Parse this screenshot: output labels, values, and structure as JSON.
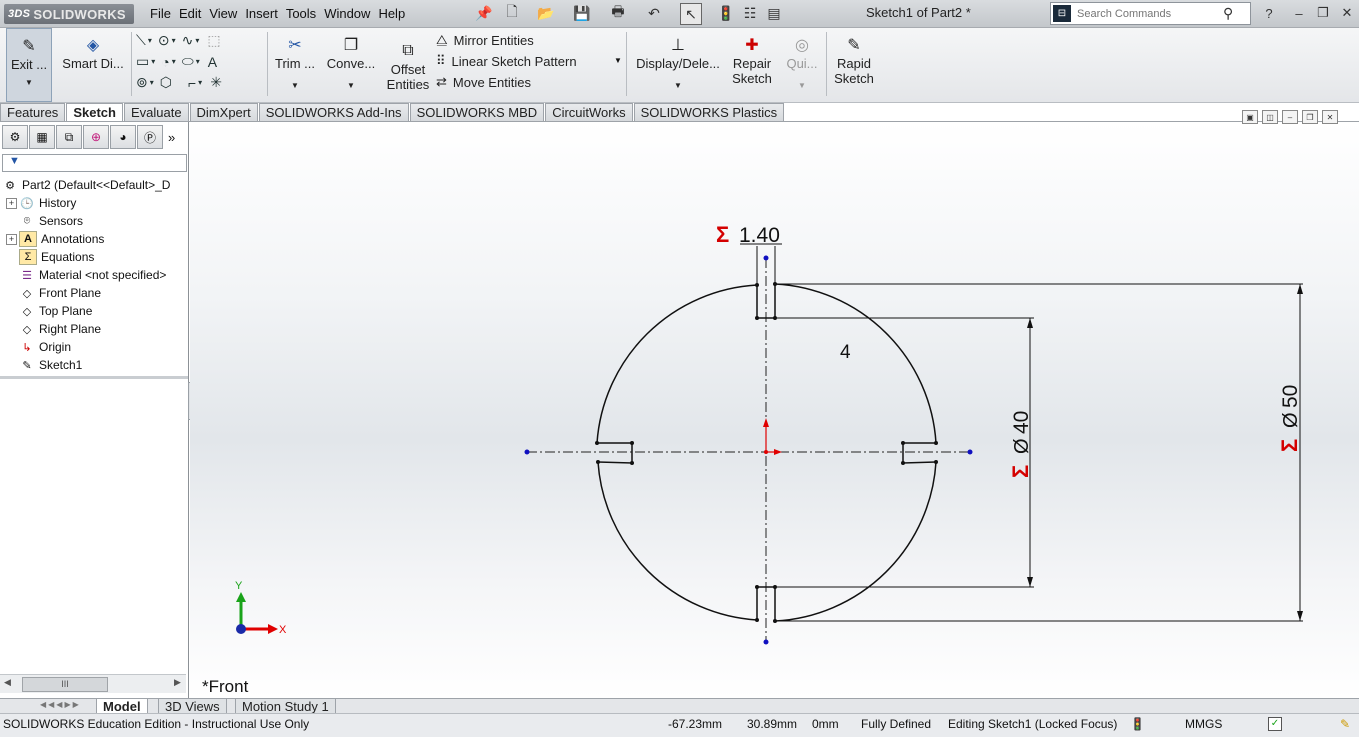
{
  "app": {
    "logo_text": "SOLIDWORKS",
    "logo_prefix": "3DS",
    "document_title": "Sketch1 of Part2 *"
  },
  "menu": [
    "File",
    "Edit",
    "View",
    "Insert",
    "Tools",
    "Window",
    "Help"
  ],
  "search": {
    "placeholder": "Search Commands"
  },
  "command_manager": {
    "exit_sketch": "Exit ...",
    "smart_dimension": "Smart Di...",
    "trim": "Trim ...",
    "convert": "Conve...",
    "offset": "Offset",
    "offset_2": "Entities",
    "mirror": "Mirror Entities",
    "linear_pattern": "Linear Sketch Pattern",
    "move": "Move Entities",
    "display_delete": "Display/Dele...",
    "repair": "Repair",
    "repair_2": "Sketch",
    "quick": "Qui...",
    "rapid": "Rapid",
    "rapid_2": "Sketch"
  },
  "tabs": [
    "Features",
    "Sketch",
    "Evaluate",
    "DimXpert",
    "SOLIDWORKS Add-Ins",
    "SOLIDWORKS MBD",
    "CircuitWorks",
    "SOLIDWORKS Plastics"
  ],
  "active_tab": "Sketch",
  "feature_tree": {
    "root": "Part2  (Default<<Default>_D",
    "items": [
      {
        "label": "History",
        "expandable": true
      },
      {
        "label": "Sensors",
        "expandable": false
      },
      {
        "label": "Annotations",
        "expandable": true
      },
      {
        "label": "Equations",
        "expandable": false
      },
      {
        "label": "Material <not specified>",
        "expandable": false
      },
      {
        "label": "Front Plane",
        "expandable": false
      },
      {
        "label": "Top Plane",
        "expandable": false
      },
      {
        "label": "Right Plane",
        "expandable": false
      },
      {
        "label": "Origin",
        "expandable": false
      },
      {
        "label": "Sketch1",
        "expandable": false
      }
    ]
  },
  "panel_scroll_label": "III",
  "graphics": {
    "view_name": "*Front",
    "dim_slot_width": "1.40",
    "dim_inner": "40",
    "dim_outer": "50",
    "dim_symbol": "Ø",
    "sum_symbol": "Σ",
    "pattern_count": "4",
    "axis_x": "X",
    "axis_y": "Y"
  },
  "bottom_tabs": [
    "Model",
    "3D Views",
    "Motion Study 1"
  ],
  "status": {
    "left": "SOLIDWORKS Education Edition - Instructional Use Only",
    "x": "-67.23mm",
    "y": "30.89mm",
    "z": "0mm",
    "state": "Fully Defined",
    "editing": "Editing Sketch1 (Locked Focus)",
    "units": "MMGS"
  },
  "colors": {
    "dimension_driven": "#d40000",
    "sketch_line": "#111111",
    "origin_red": "#e00000",
    "point_blue": "#1010c0",
    "axis_green": "#1aa31a"
  }
}
